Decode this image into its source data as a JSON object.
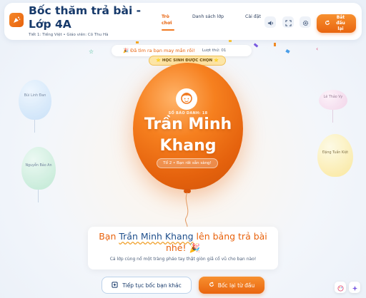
{
  "header": {
    "title": "Bốc thăm trả bài - Lớp 4A",
    "subtitle": "Tiết 1: Tiếng Việt • Giáo viên: Cô Thu Hà",
    "tabs": [
      {
        "label": "Trò chơi",
        "active": true
      },
      {
        "label": "Danh sách lớp",
        "active": false
      },
      {
        "label": "Cài đặt",
        "active": false
      }
    ],
    "restart_label": "Bắt đầu lại",
    "icons": [
      "sound-icon",
      "fullscreen-icon",
      "settings-icon"
    ]
  },
  "status": {
    "luck_text": "🎉 Đã tìm ra bạn may mắn rồi!",
    "round_text": "Lượt thứ: 01",
    "selected_label": "⭐ HỌC SINH ĐƯỢC CHỌN ⭐"
  },
  "selected_student": {
    "sbd_label": "SỐ BÁO DANH: 18",
    "name": "Trần Minh Khang",
    "group": "Tổ 2 • Bạn rất sẵn sàng!"
  },
  "side_balloons": [
    {
      "name": "Bùi Linh Đan",
      "color": "#cfe6fb"
    },
    {
      "name": "Nguyễn Bảo An",
      "color": "#cdeedd"
    },
    {
      "name": "Lê Thảo Vy",
      "color": "#f7dcee"
    },
    {
      "name": "Đặng Tuấn Kiệt",
      "color": "#fff0b8"
    }
  ],
  "announcement": {
    "prefix": "Bạn ",
    "name": "Trần Minh Khang",
    "suffix": " lên bảng trả bài nhé! 🎉",
    "subtext": "Cả lớp cùng nổ một tràng pháo tay thật giòn giã cổ vũ cho bạn nào!"
  },
  "actions": {
    "continue_label": "Tiếp tục bốc bạn khác",
    "redraw_label": "Bốc lại từ đầu"
  },
  "colors": {
    "accent": "#e8620c",
    "navy": "#173a6b"
  }
}
